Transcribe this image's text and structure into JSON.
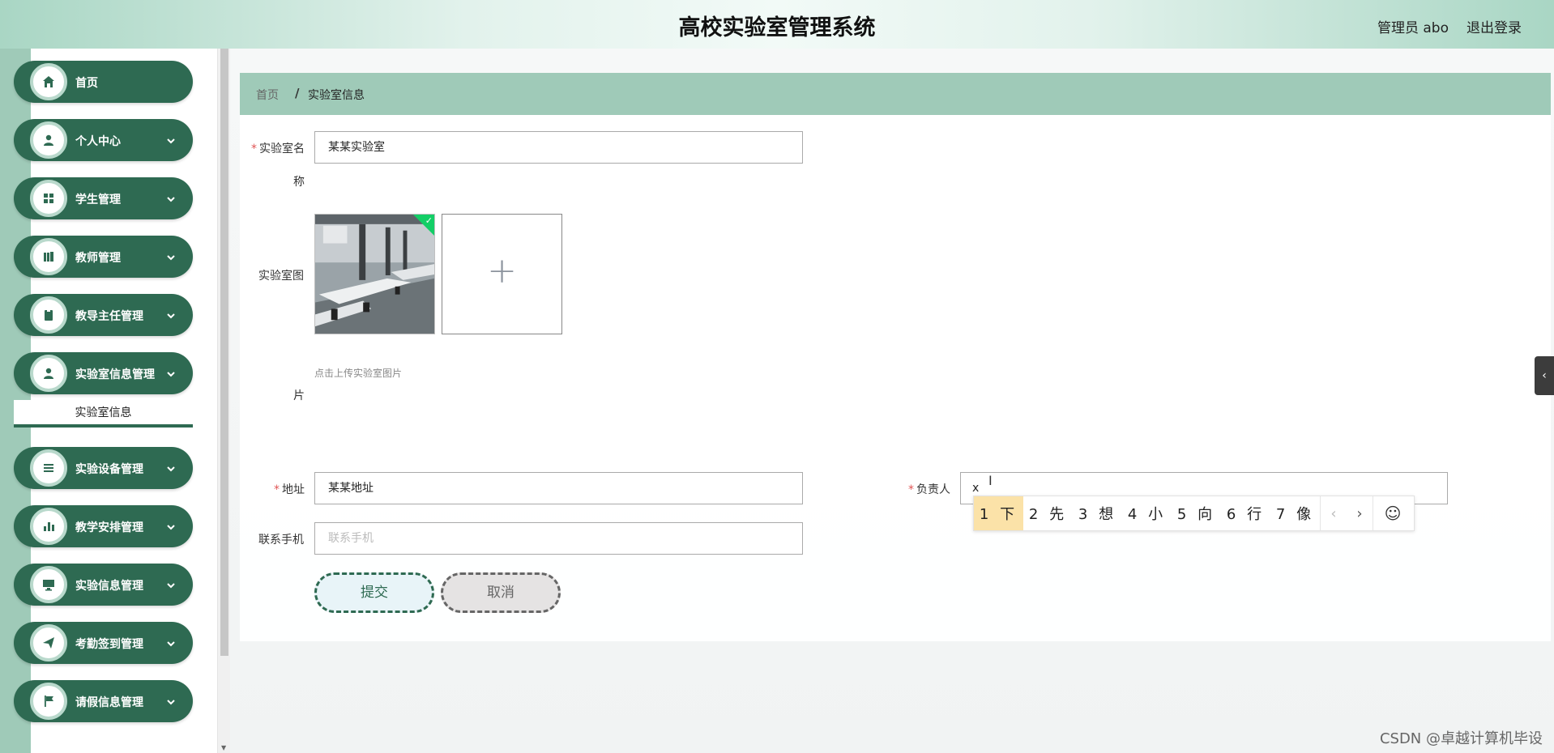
{
  "header": {
    "title": "高校实验室管理系统",
    "user": "管理员 abo",
    "logout": "退出登录"
  },
  "sidebar": {
    "items": [
      {
        "label": "首页",
        "icon": "home-icon"
      },
      {
        "label": "个人中心",
        "icon": "user-icon"
      },
      {
        "label": "学生管理",
        "icon": "grid-icon"
      },
      {
        "label": "教师管理",
        "icon": "book-icon"
      },
      {
        "label": "教导主任管理",
        "icon": "clipboard-icon"
      },
      {
        "label": "实验室信息管理",
        "icon": "user-icon"
      },
      {
        "label": "实验设备管理",
        "icon": "list-icon"
      },
      {
        "label": "教学安排管理",
        "icon": "bar-chart-icon"
      },
      {
        "label": "实验信息管理",
        "icon": "monitor-icon"
      },
      {
        "label": "考勤签到管理",
        "icon": "send-icon"
      },
      {
        "label": "请假信息管理",
        "icon": "flag-icon"
      }
    ],
    "active_submenu": "实验室信息"
  },
  "breadcrumb": {
    "home": "首页",
    "separator": "/",
    "current": "实验室信息"
  },
  "form": {
    "name_label_line1": "实验室名",
    "name_label_line2": "称",
    "name_value": "某某实验室",
    "image_label_line1": "实验室图",
    "image_label_line2": "片",
    "upload_tip": "点击上传实验室图片",
    "upload_plus": "+",
    "address_label": "地址",
    "address_value": "某某地址",
    "owner_label": "负责人",
    "owner_value": "x",
    "phone_label": "联系手机",
    "phone_placeholder": "联系手机",
    "required_mark": "*",
    "submit": "提交",
    "cancel": "取消"
  },
  "ime": {
    "candidates": [
      "1 下",
      "2 先",
      "3 想",
      "4 小",
      "5 向",
      "6 行",
      "7 像"
    ],
    "prev": "‹",
    "next": "›",
    "emoji": "☺"
  },
  "side_tab": "‹",
  "watermark": "CSDN @卓越计算机毕设",
  "colors": {
    "primary": "#2e6a52",
    "accent": "#9fcab8",
    "ime_selected": "#fbe2a8"
  }
}
